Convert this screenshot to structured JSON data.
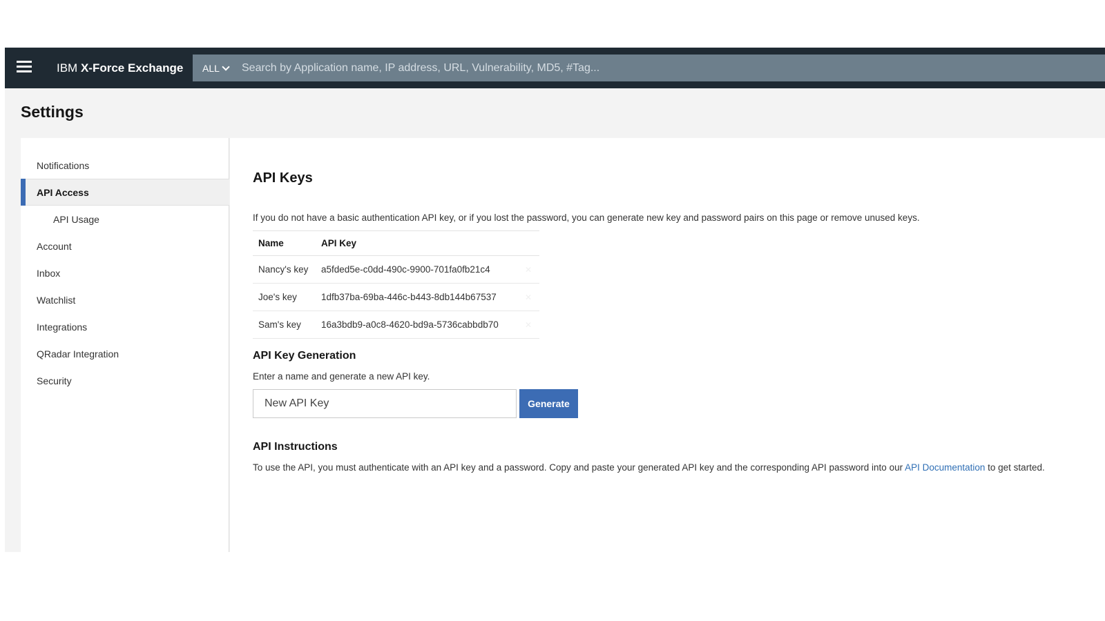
{
  "topbar": {
    "brand_prefix": "IBM",
    "brand_name": "X-Force Exchange",
    "search_scope": "ALL",
    "search_placeholder": "Search by Application name, IP address, URL, Vulnerability, MD5, #Tag..."
  },
  "page_title": "Settings",
  "sidebar": {
    "items": [
      {
        "label": "Notifications"
      },
      {
        "label": "API Access"
      },
      {
        "label": "API Usage"
      },
      {
        "label": "Account"
      },
      {
        "label": "Inbox"
      },
      {
        "label": "Watchlist"
      },
      {
        "label": "Integrations"
      },
      {
        "label": "QRadar Integration"
      },
      {
        "label": "Security"
      }
    ],
    "active_label": "API Access"
  },
  "api_keys": {
    "heading": "API Keys",
    "intro": "If you do not have a basic authentication API key, or if you lost the password, you can generate new key and password pairs on this page or remove unused keys.",
    "columns": [
      "Name",
      "API Key"
    ],
    "rows": [
      {
        "name": "Nancy's key",
        "key": "a5fded5e-c0dd-490c-9900-701fa0fb21c4"
      },
      {
        "name": "Joe's key",
        "key": "1dfb37ba-69ba-446c-b443-8db144b67537"
      },
      {
        "name": "Sam's key",
        "key": "16a3bdb9-a0c8-4620-bd9a-5736cabbdb70"
      }
    ]
  },
  "generation": {
    "heading": "API Key Generation",
    "description": "Enter a name and generate a new API key.",
    "input_placeholder": "New API Key",
    "button_label": "Generate"
  },
  "instructions": {
    "heading": "API Instructions",
    "text_before": "To use the API, you must authenticate with an API key and a password. Copy and paste your generated API key and the corresponding API password into our ",
    "link_text": "API Documentation",
    "text_after": " to get started."
  },
  "colors": {
    "topbar_bg": "#1f2a33",
    "search_bg": "#6d7f8c",
    "accent": "#3c6cb4",
    "link": "#2f6fb5"
  }
}
